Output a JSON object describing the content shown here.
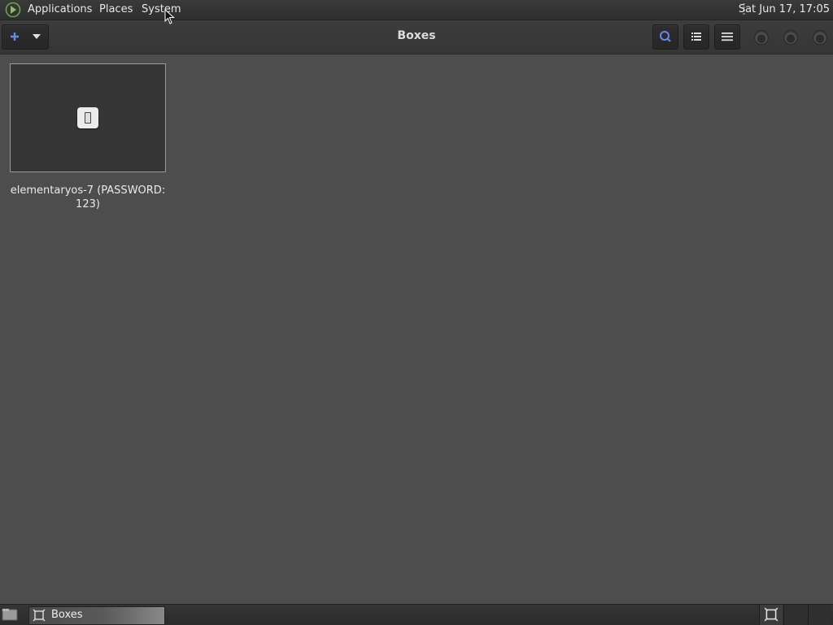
{
  "top_panel": {
    "menus": [
      "Applications",
      "Places",
      "System"
    ],
    "clock": "Sat Jun 17, 17:05"
  },
  "headerbar": {
    "title": "Boxes"
  },
  "boxes": [
    {
      "label": "elementaryos-7 (PASSWORD: 123)"
    }
  ],
  "taskbar": {
    "window_label": "Boxes"
  },
  "colors": {
    "accent_blue": "#5b8fe0",
    "background": "#4d4d4d"
  },
  "icons": {
    "menu_logo": "mate-logo-icon",
    "new_box": "plus-icon",
    "search": "search-icon",
    "list_view": "list-view-icon",
    "hamburger": "hamburger-menu-icon",
    "box": "vm-screen-icon",
    "show_desktop": "show-desktop-icon",
    "task": "boxes-app-icon"
  }
}
